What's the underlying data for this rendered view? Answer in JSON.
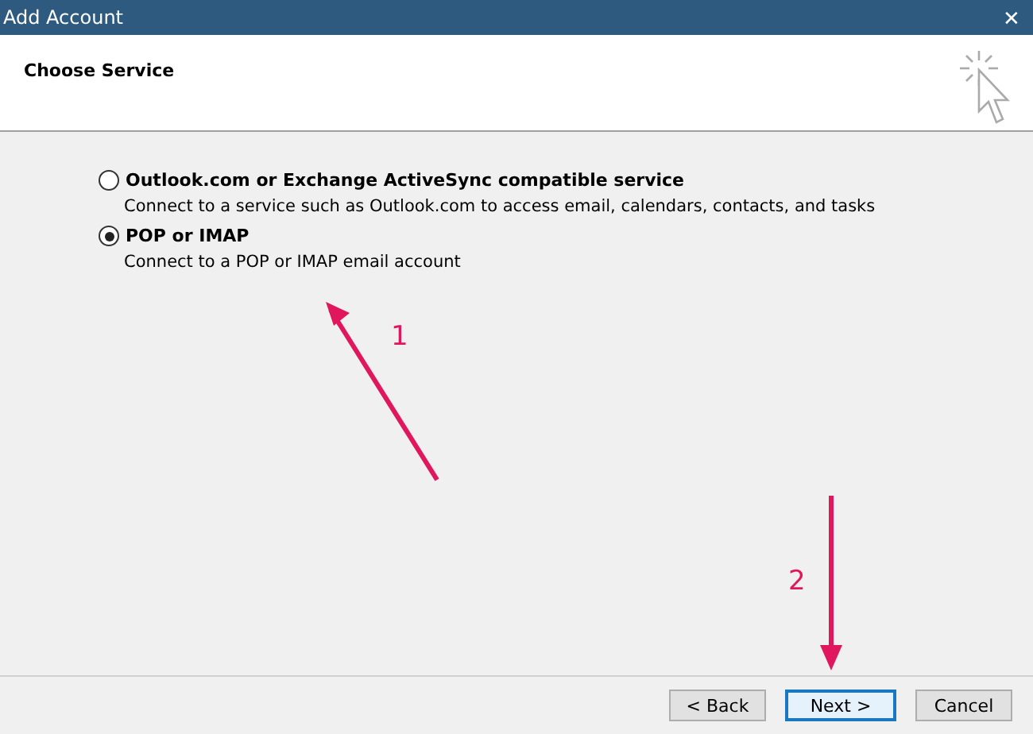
{
  "window": {
    "title": "Add Account",
    "close": "✕"
  },
  "header": {
    "title": "Choose Service"
  },
  "options": [
    {
      "label": "Outlook.com or Exchange ActiveSync compatible service",
      "description": "Connect to a service such as Outlook.com to access email, calendars, contacts, and tasks",
      "selected": false
    },
    {
      "label": "POP or IMAP",
      "description": "Connect to a POP or IMAP email account",
      "selected": true
    }
  ],
  "buttons": [
    {
      "label": "< Back",
      "focused": false
    },
    {
      "label": "Next >",
      "focused": true
    },
    {
      "label": "Cancel",
      "focused": false
    }
  ],
  "annotations": [
    {
      "label": "1"
    },
    {
      "label": "2"
    }
  ]
}
